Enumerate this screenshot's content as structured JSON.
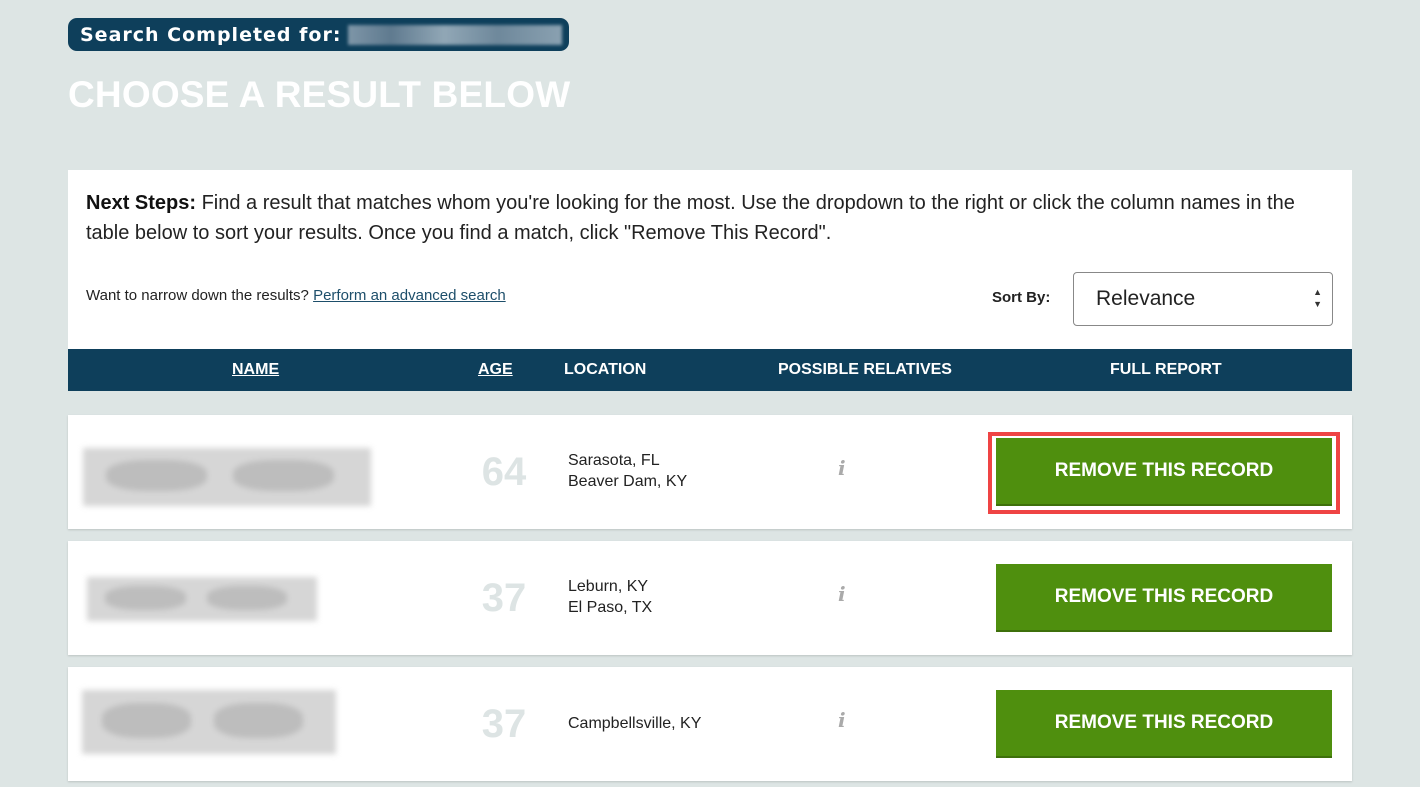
{
  "header": {
    "search_label": "Search Completed for:",
    "title": "CHOOSE A RESULT BELOW"
  },
  "instructions": {
    "bold": "Next Steps:",
    "text": " Find a result that matches whom you're looking for the most. Use the dropdown to the right or click the column names in the table below to sort your results. Once you find a match, click \"Remove This Record\".",
    "narrow_prompt": "Want to narrow down the results?",
    "advanced_link": "Perform an advanced search",
    "sort_label": "Sort By:",
    "sort_value": "Relevance"
  },
  "table": {
    "columns": {
      "name": "NAME",
      "age": "AGE",
      "location": "LOCATION",
      "relatives": "POSSIBLE RELATIVES",
      "report": "FULL REPORT"
    },
    "rows": [
      {
        "age": "64",
        "locations": [
          "Sarasota, FL",
          "Beaver Dam, KY"
        ],
        "info_icon": "i",
        "button": "REMOVE THIS RECORD"
      },
      {
        "age": "37",
        "locations": [
          "Leburn, KY",
          "El Paso, TX"
        ],
        "info_icon": "i",
        "button": "REMOVE THIS RECORD"
      },
      {
        "age": "37",
        "locations": [
          "Campbellsville, KY"
        ],
        "info_icon": "i",
        "button": "REMOVE THIS RECORD"
      }
    ]
  },
  "colors": {
    "background": "#dde5e4",
    "header_navy": "#0e3f5b",
    "button_green": "#4f8f0e",
    "highlight_red": "#ef4444"
  }
}
